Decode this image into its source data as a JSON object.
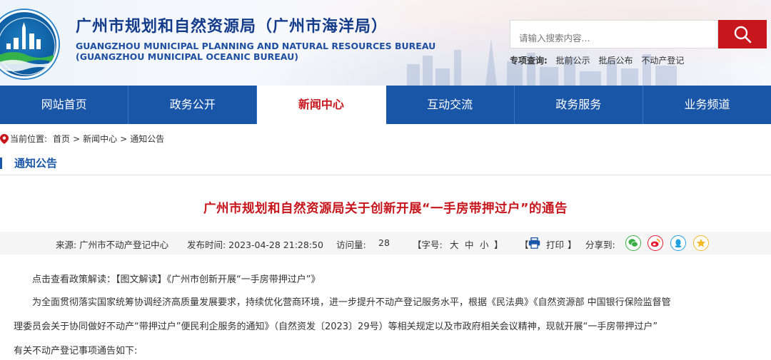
{
  "header": {
    "title_cn": "广州市规划和自然资源局（广州市海洋局）",
    "title_en_1": "GUANGZHOU MUNICIPAL PLANNING AND NATURAL RESOURCES BUREAU",
    "title_en_2": "(GUANGZHOU MUNICIPAL OCEANIC BUREAU)",
    "logo_text": "广州市规划和自然资源局",
    "search_placeholder": "请输入搜索内容...",
    "special_label": "专项查询:",
    "special_links": [
      "批前公示",
      "批后公布",
      "不动产登记"
    ]
  },
  "nav": [
    "网站首页",
    "政务公开",
    "新闻中心",
    "互动交流",
    "政务服务",
    "业务频道"
  ],
  "nav_active_index": 2,
  "breadcrumb": {
    "label": "当前位置:",
    "items": [
      "首页",
      "新闻中心",
      "通知公告"
    ],
    "sep": ">"
  },
  "section_title": "通知公告",
  "article": {
    "title": "广州市规划和自然资源局关于创新开展“一手房带押过户”的通告",
    "source": "来源: 广州市不动产登记中心",
    "publish_time": "发布时间: 2023-04-28 21:28:50",
    "views_label": "访问量:",
    "views": "28",
    "font_label": "【字号:",
    "font_sizes": [
      "大",
      "中",
      "小"
    ],
    "font_end": "】",
    "print_open": "【",
    "print_label": "打印",
    "print_close": "】",
    "share_label": "分享到:",
    "paragraphs": [
      "点击查看政策解读：【图文解读】《广州市创新开展“一手房带押过户”》",
      "为全面贯彻落实国家统筹协调经济高质量发展要求，持续优化营商环境，进一步提升不动产登记服务水平，根据《民法典》《自然资源部 中国银行保险监督管",
      "理委员会关于协同做好不动产“带押过户”便民利企服务的通知》（自然资发〔2023〕29号）等相关规定以及市政府相关会议精神，现就开展“一手房带押过户”",
      "有关不动产登记事项通告如下:"
    ]
  },
  "colors": {
    "primary_blue": "#1a56a8",
    "accent_red": "#c8161d",
    "wechat": "#3aae45",
    "weibo": "#e6162d",
    "qq": "#1fa0e3",
    "qzone": "#f4b728"
  }
}
